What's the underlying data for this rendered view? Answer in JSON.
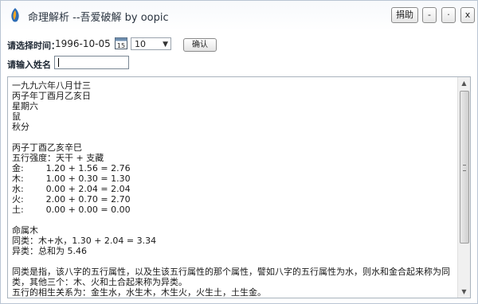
{
  "window": {
    "title": "命理解析 --吾爱破解 by oopic",
    "buttons": {
      "donate": "捐助",
      "minimize": "-",
      "maximize": "·",
      "close": "x"
    }
  },
  "form": {
    "date_label": "请选择时间：",
    "date_value": "1996-10-05",
    "calendar_icon_number": "15",
    "hour_select": "10",
    "confirm_label": "确认",
    "name_label": "请输入姓名",
    "name_value": ""
  },
  "output": {
    "lines": [
      "一九九六年八月廿三",
      "丙子年丁酉月乙亥日",
      "星期六",
      "鼠",
      "秋分",
      "",
      "丙子丁酉乙亥辛巳",
      "五行强度：天干 + 支藏",
      "金:        1.20 + 1.56 = 2.76",
      "木:        1.00 + 0.30 = 1.30",
      "水:        0.00 + 2.04 = 2.04",
      "火:        2.00 + 0.70 = 2.70",
      "土:        0.00 + 0.00 = 0.00",
      "",
      "命属木",
      "同类：木+水，1.30 + 2.04 = 3.34",
      "异类：总和为 5.46",
      "",
      "同类是指，该八字的五行属性，以及生该五行属性的那个属性，譬如八字的五行属性为水，则水和金合起来称为同类，其他三个：木、火和土合起来称为异类。",
      "五行的相生关系为：金生水，水生木，木生火，火生土，土生金。"
    ]
  },
  "icons": {
    "app": "app-logo-icon",
    "calendar": "calendar-icon",
    "dropdown": "chevron-down-icon",
    "scroll_up": "scroll-up-icon",
    "scroll_down": "scroll-down-icon"
  },
  "colors": {
    "title_text": "#2a3440",
    "border": "#a9b3bd",
    "app_icon_blue": "#2e6db4"
  }
}
